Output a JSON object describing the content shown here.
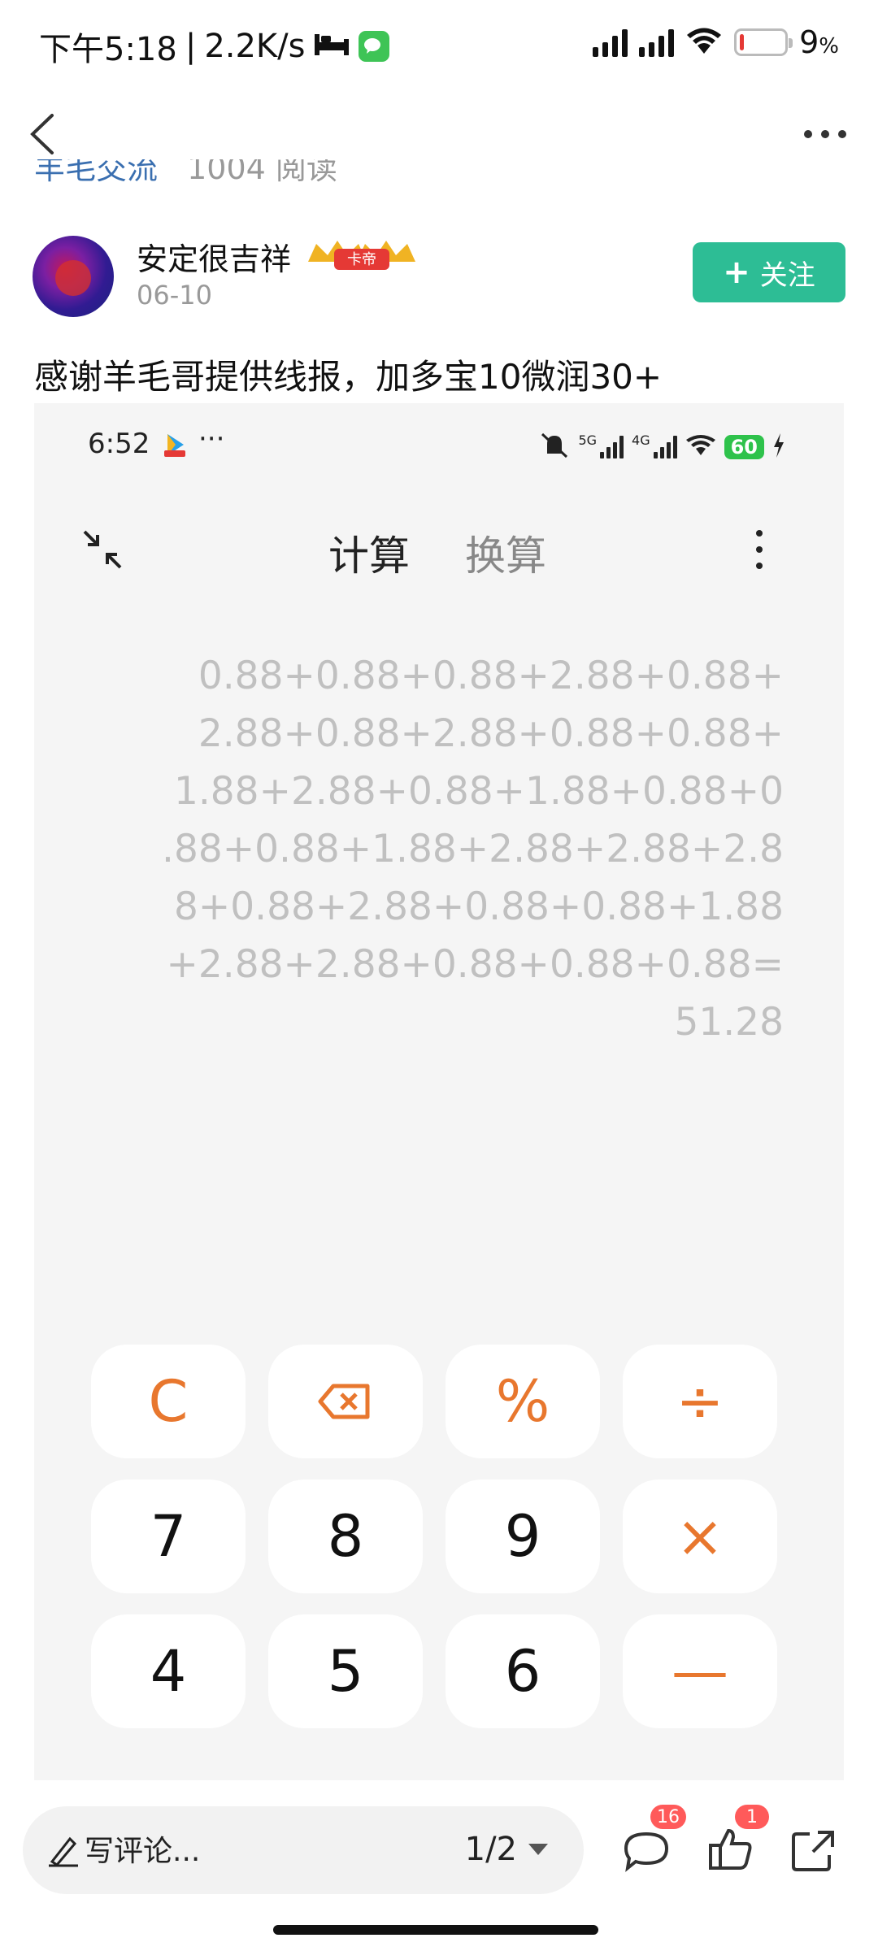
{
  "status_bar": {
    "time": "下午5:18",
    "speed": "2.2K/s",
    "battery": "9",
    "battery_unit": "%",
    "battery_level": 0.09,
    "icons": [
      "bed-icon",
      "wechat-icon",
      "signal-icon",
      "signal-icon",
      "wifi-icon",
      "battery-icon"
    ]
  },
  "nav": {
    "back_icon": "chevron-left-icon",
    "more_icon": "more-horizontal-icon",
    "cut_off_text_left": "羊毛交流",
    "cut_off_text_right": "1004 阅读"
  },
  "author": {
    "name": "安定很吉祥",
    "badge": "卡帝",
    "date": "06-10",
    "follow_label": "关注",
    "follow_plus": "+"
  },
  "post": {
    "text": "感谢羊毛哥提供线报，加多宝10微润30+"
  },
  "embedded": {
    "status_time": "6:52",
    "status_dots": "···",
    "battery": "60",
    "net_5g": "5G",
    "net_4g": "4G",
    "tabs": [
      "计算",
      "换算"
    ],
    "expression_lines": [
      "0.88+0.88+0.88+2.88+0.88+",
      "2.88+0.88+2.88+0.88+0.88+",
      "1.88+2.88+0.88+1.88+0.88+0",
      ".88+0.88+1.88+2.88+2.88+2.8",
      "8+0.88+2.88+0.88+0.88+1.88",
      "+2.88+2.88+0.88+0.88+0.88=",
      "51.28"
    ],
    "keys": [
      {
        "label": "C",
        "name": "clear-key",
        "orange": true
      },
      {
        "label": "",
        "name": "backspace-key",
        "orange": true
      },
      {
        "label": "%",
        "name": "percent-key",
        "orange": true
      },
      {
        "label": "÷",
        "name": "divide-key",
        "orange": true
      },
      {
        "label": "7",
        "name": "key-7",
        "orange": false
      },
      {
        "label": "8",
        "name": "key-8",
        "orange": false
      },
      {
        "label": "9",
        "name": "key-9",
        "orange": false
      },
      {
        "label": "×",
        "name": "multiply-key",
        "orange": true
      },
      {
        "label": "4",
        "name": "key-4",
        "orange": false
      },
      {
        "label": "5",
        "name": "key-5",
        "orange": false
      },
      {
        "label": "6",
        "name": "key-6",
        "orange": false
      },
      {
        "label": "—",
        "name": "minus-key",
        "orange": true
      }
    ],
    "accent": "#e8772e"
  },
  "bottom_bar": {
    "comment_placeholder": "写评论...",
    "pager": "1/2",
    "comment_count": "16",
    "like_count": "1",
    "share_icon": "share-icon"
  },
  "colors": {
    "follow": "#2dbd95",
    "badge": "#ff5a5a"
  }
}
